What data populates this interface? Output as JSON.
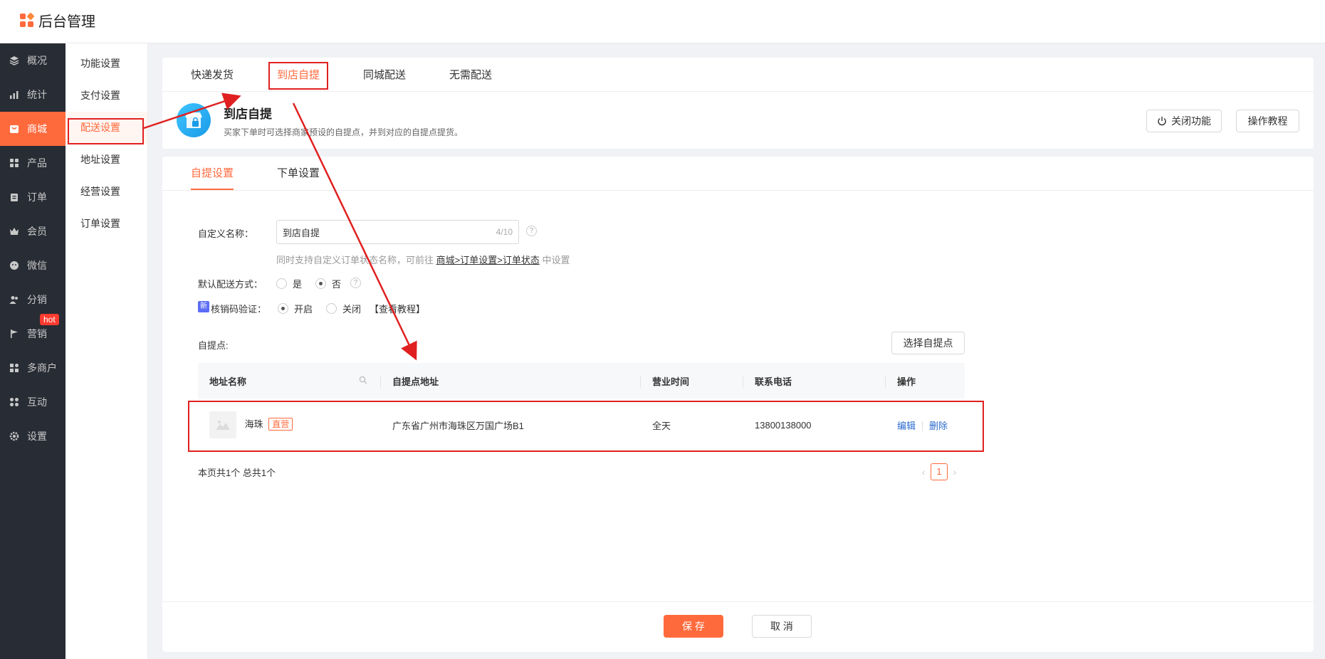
{
  "app": {
    "title": "后台管理"
  },
  "sidebar": {
    "items": [
      {
        "label": "概况",
        "icon": "layers-icon"
      },
      {
        "label": "统计",
        "icon": "chart-icon"
      },
      {
        "label": "商城",
        "icon": "shop-icon",
        "active": true
      },
      {
        "label": "产品",
        "icon": "grid-icon"
      },
      {
        "label": "订单",
        "icon": "clipboard-icon"
      },
      {
        "label": "会员",
        "icon": "crown-icon"
      },
      {
        "label": "微信",
        "icon": "wechat-icon"
      },
      {
        "label": "分销",
        "icon": "users-icon"
      },
      {
        "label": "营销",
        "icon": "flag-icon",
        "badge": "hot"
      },
      {
        "label": "多商户",
        "icon": "store-icon"
      },
      {
        "label": "互动",
        "icon": "apps-icon"
      },
      {
        "label": "设置",
        "icon": "gear-icon"
      }
    ]
  },
  "subsidebar": {
    "items": [
      "功能设置",
      "支付设置",
      "配送设置",
      "地址设置",
      "经营设置",
      "订单设置"
    ],
    "active_index": 2
  },
  "delivery_tabs": [
    "快递发货",
    "到店自提",
    "同城配送",
    "无需配送"
  ],
  "feature": {
    "title": "到店自提",
    "desc": "买家下单时可选择商家预设的自提点，并到对应的自提点提货。",
    "close_button": "关闭功能",
    "tutorial_button": "操作教程"
  },
  "settings_tabs": [
    "自提设置",
    "下单设置"
  ],
  "form": {
    "name_label": "自定义名称：",
    "name_value": "到店自提",
    "name_count": "4/10",
    "hint_prefix": "同时支持自定义订单状态名称，可前往",
    "hint_link": "商城>订单设置>订单状态",
    "hint_suffix": "中设置",
    "default_label": "默认配送方式：",
    "default_yes": "是",
    "default_no": "否",
    "verify_badge": "新",
    "verify_label": "核销码验证：",
    "verify_on": "开启",
    "verify_off": "关闭",
    "verify_tutorial": "【查看教程】",
    "points_label": "自提点:",
    "select_button": "选择自提点"
  },
  "table": {
    "headers": [
      "地址名称",
      "自提点地址",
      "营业时间",
      "联系电话",
      "操作"
    ],
    "rows": [
      {
        "name": "海珠",
        "tag": "直营",
        "address": "广东省广州市海珠区万国广场B1",
        "hours": "全天",
        "phone": "13800138000",
        "edit": "编辑",
        "delete": "删除"
      }
    ]
  },
  "pagination": {
    "info": "本页共1个 总共1个",
    "current": "1",
    "prev": "‹",
    "next": "›"
  },
  "footer": {
    "save": "保 存",
    "cancel": "取 消"
  },
  "colors": {
    "accent": "#ff6a3d",
    "sidebar_bg": "#282c34",
    "annotation": "#e02020",
    "link": "#2d6ccf"
  }
}
